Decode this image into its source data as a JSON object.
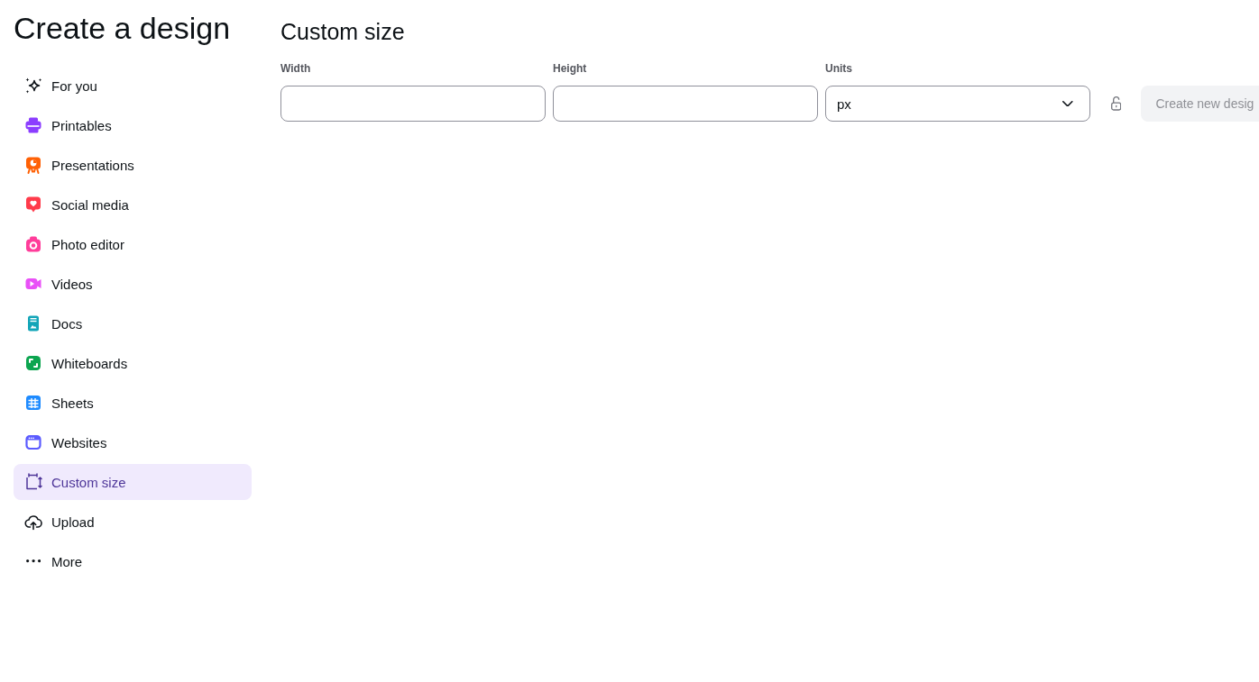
{
  "sidebar": {
    "title": "Create a design",
    "items": [
      {
        "label": "For you",
        "selected": false
      },
      {
        "label": "Printables",
        "selected": false
      },
      {
        "label": "Presentations",
        "selected": false
      },
      {
        "label": "Social media",
        "selected": false
      },
      {
        "label": "Photo editor",
        "selected": false
      },
      {
        "label": "Videos",
        "selected": false
      },
      {
        "label": "Docs",
        "selected": false
      },
      {
        "label": "Whiteboards",
        "selected": false
      },
      {
        "label": "Sheets",
        "selected": false
      },
      {
        "label": "Websites",
        "selected": false
      },
      {
        "label": "Custom size",
        "selected": true
      },
      {
        "label": "Upload",
        "selected": false
      },
      {
        "label": "More",
        "selected": false
      }
    ]
  },
  "custom_size": {
    "title": "Custom size",
    "width_field": {
      "label": "Width"
    },
    "height_field": {
      "label": "Height"
    },
    "units_select": {
      "label": "Units",
      "value": "px"
    },
    "aspect_lock": {
      "locked": false
    },
    "create_button": {
      "label": "Create new desig",
      "disabled": true
    }
  }
}
